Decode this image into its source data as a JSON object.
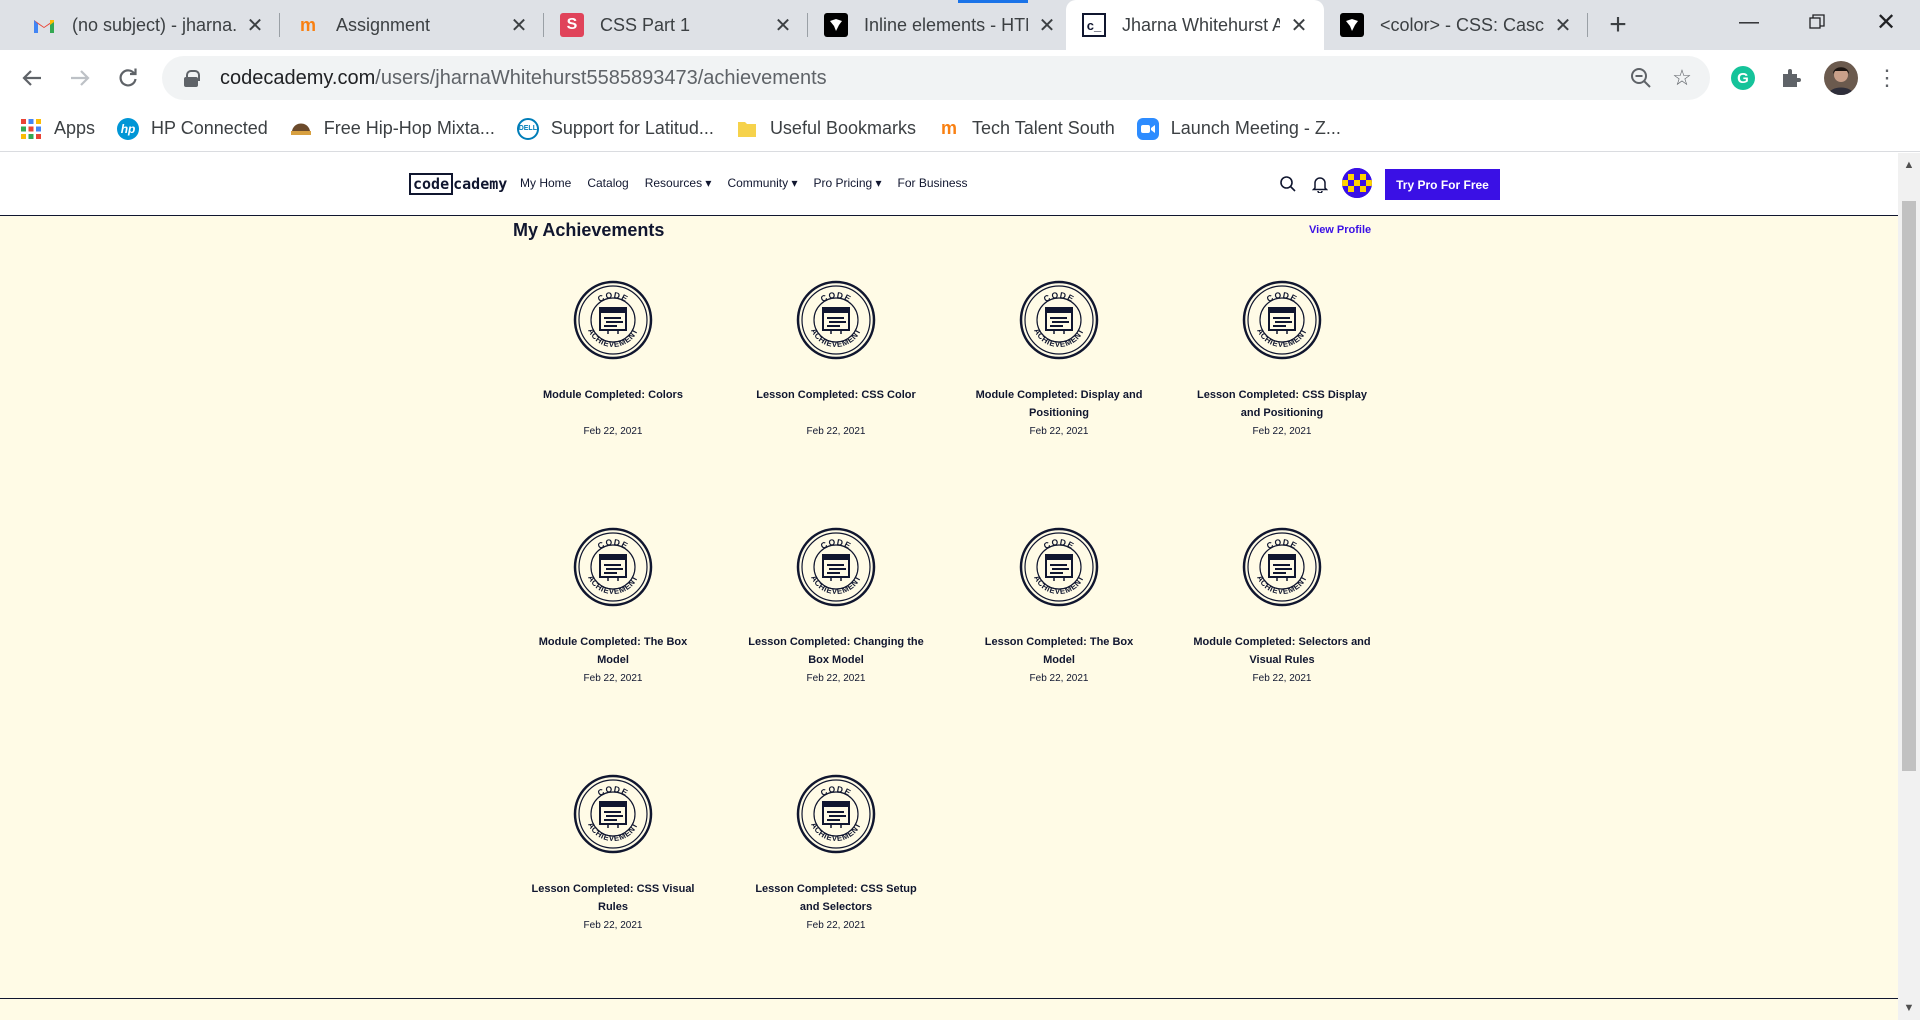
{
  "browser": {
    "tabs": [
      {
        "title": "(no subject) - jharna.",
        "icon": "gmail-icon",
        "active": false
      },
      {
        "title": "Assignment",
        "icon": "moodle-icon",
        "active": false
      },
      {
        "title": "CSS Part 1",
        "icon": "s-icon",
        "active": false
      },
      {
        "title": "Inline elements - HTM",
        "icon": "mdn-icon",
        "active": false
      },
      {
        "title": "Jharna Whitehurst Ac",
        "icon": "codecademy-icon",
        "active": true
      },
      {
        "title": "<color> - CSS: Casca",
        "icon": "mdn-icon",
        "active": false
      }
    ],
    "url_domain": "codecademy.com",
    "url_path": "/users/jharnaWhitehurst5585893473/achievements",
    "bookmarks": [
      {
        "label": "Apps",
        "icon": "apps-grid-icon"
      },
      {
        "label": "HP Connected",
        "icon": "hp-icon"
      },
      {
        "label": "Free Hip-Hop Mixta...",
        "icon": "hiphop-icon"
      },
      {
        "label": "Support for Latitud...",
        "icon": "dell-icon"
      },
      {
        "label": "Useful Bookmarks",
        "icon": "folder-icon"
      },
      {
        "label": "Tech Talent South",
        "icon": "tts-icon"
      },
      {
        "label": "Launch Meeting - Z...",
        "icon": "zoom-icon"
      }
    ]
  },
  "site": {
    "logo_boxed": "code",
    "logo_rest": "cademy",
    "nav": [
      {
        "label": "My Home"
      },
      {
        "label": "Catalog"
      },
      {
        "label": "Resources ▾"
      },
      {
        "label": "Community ▾"
      },
      {
        "label": "Pro Pricing ▾"
      },
      {
        "label": "For Business"
      }
    ],
    "cta": "Try Pro For Free"
  },
  "page": {
    "title": "My Achievements",
    "view_profile": "View Profile",
    "badge_top_text": "CODE",
    "badge_bottom_text": "ACHIEVEMENT",
    "achievements": [
      {
        "title": "Module Completed: Colors",
        "date": "Feb 22, 2021"
      },
      {
        "title": "Lesson Completed: CSS Color",
        "date": "Feb 22, 2021"
      },
      {
        "title": "Module Completed: Display and Positioning",
        "date": "Feb 22, 2021"
      },
      {
        "title": "Lesson Completed: CSS Display and Positioning",
        "date": "Feb 22, 2021"
      },
      {
        "title": "Module Completed: The Box Model",
        "date": "Feb 22, 2021"
      },
      {
        "title": "Lesson Completed: Changing the Box Model",
        "date": "Feb 22, 2021"
      },
      {
        "title": "Lesson Completed: The Box Model",
        "date": "Feb 22, 2021"
      },
      {
        "title": "Module Completed: Selectors and Visual Rules",
        "date": "Feb 22, 2021"
      },
      {
        "title": "Lesson Completed: CSS Visual Rules",
        "date": "Feb 22, 2021"
      },
      {
        "title": "Lesson Completed: CSS Setup and Selectors",
        "date": "Feb 22, 2021"
      }
    ]
  },
  "colors": {
    "accent": "#3a10e5",
    "page_bg": "#fffbe6",
    "ink": "#10162f"
  }
}
